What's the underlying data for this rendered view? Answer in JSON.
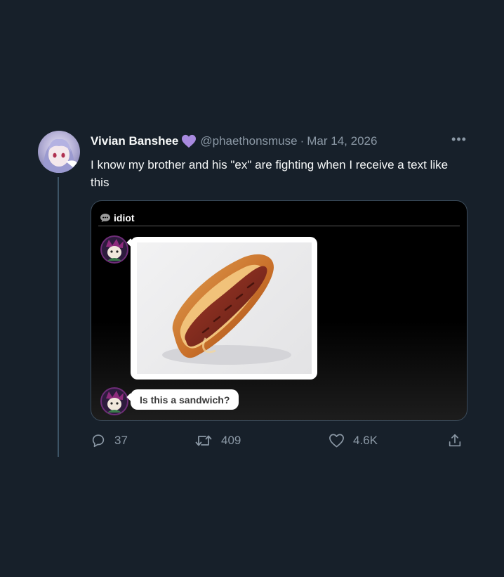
{
  "tweet": {
    "author_name": "Vivian Banshee",
    "handle": "@phaethonsmuse",
    "separator": "·",
    "date": "Mar 14, 2026",
    "more_label": "•••",
    "text": "I know my brother and his \"ex\" are fighting when I receive a text like this",
    "badge_icon": "purple-heart-icon",
    "badge_color": "#a88adf"
  },
  "media": {
    "channel_name": "idiot",
    "channel_icon": "speech-bubble-icon",
    "image_subject": "hot-dog-photo",
    "message_text": "Is this a sandwich?"
  },
  "actions": {
    "replies": "37",
    "retweets": "409",
    "likes": "4.6K"
  },
  "colors": {
    "background": "#17202a",
    "secondary_text": "#8b98a5",
    "primary_text": "#f7f9f9",
    "thread_line": "#3d5466"
  }
}
